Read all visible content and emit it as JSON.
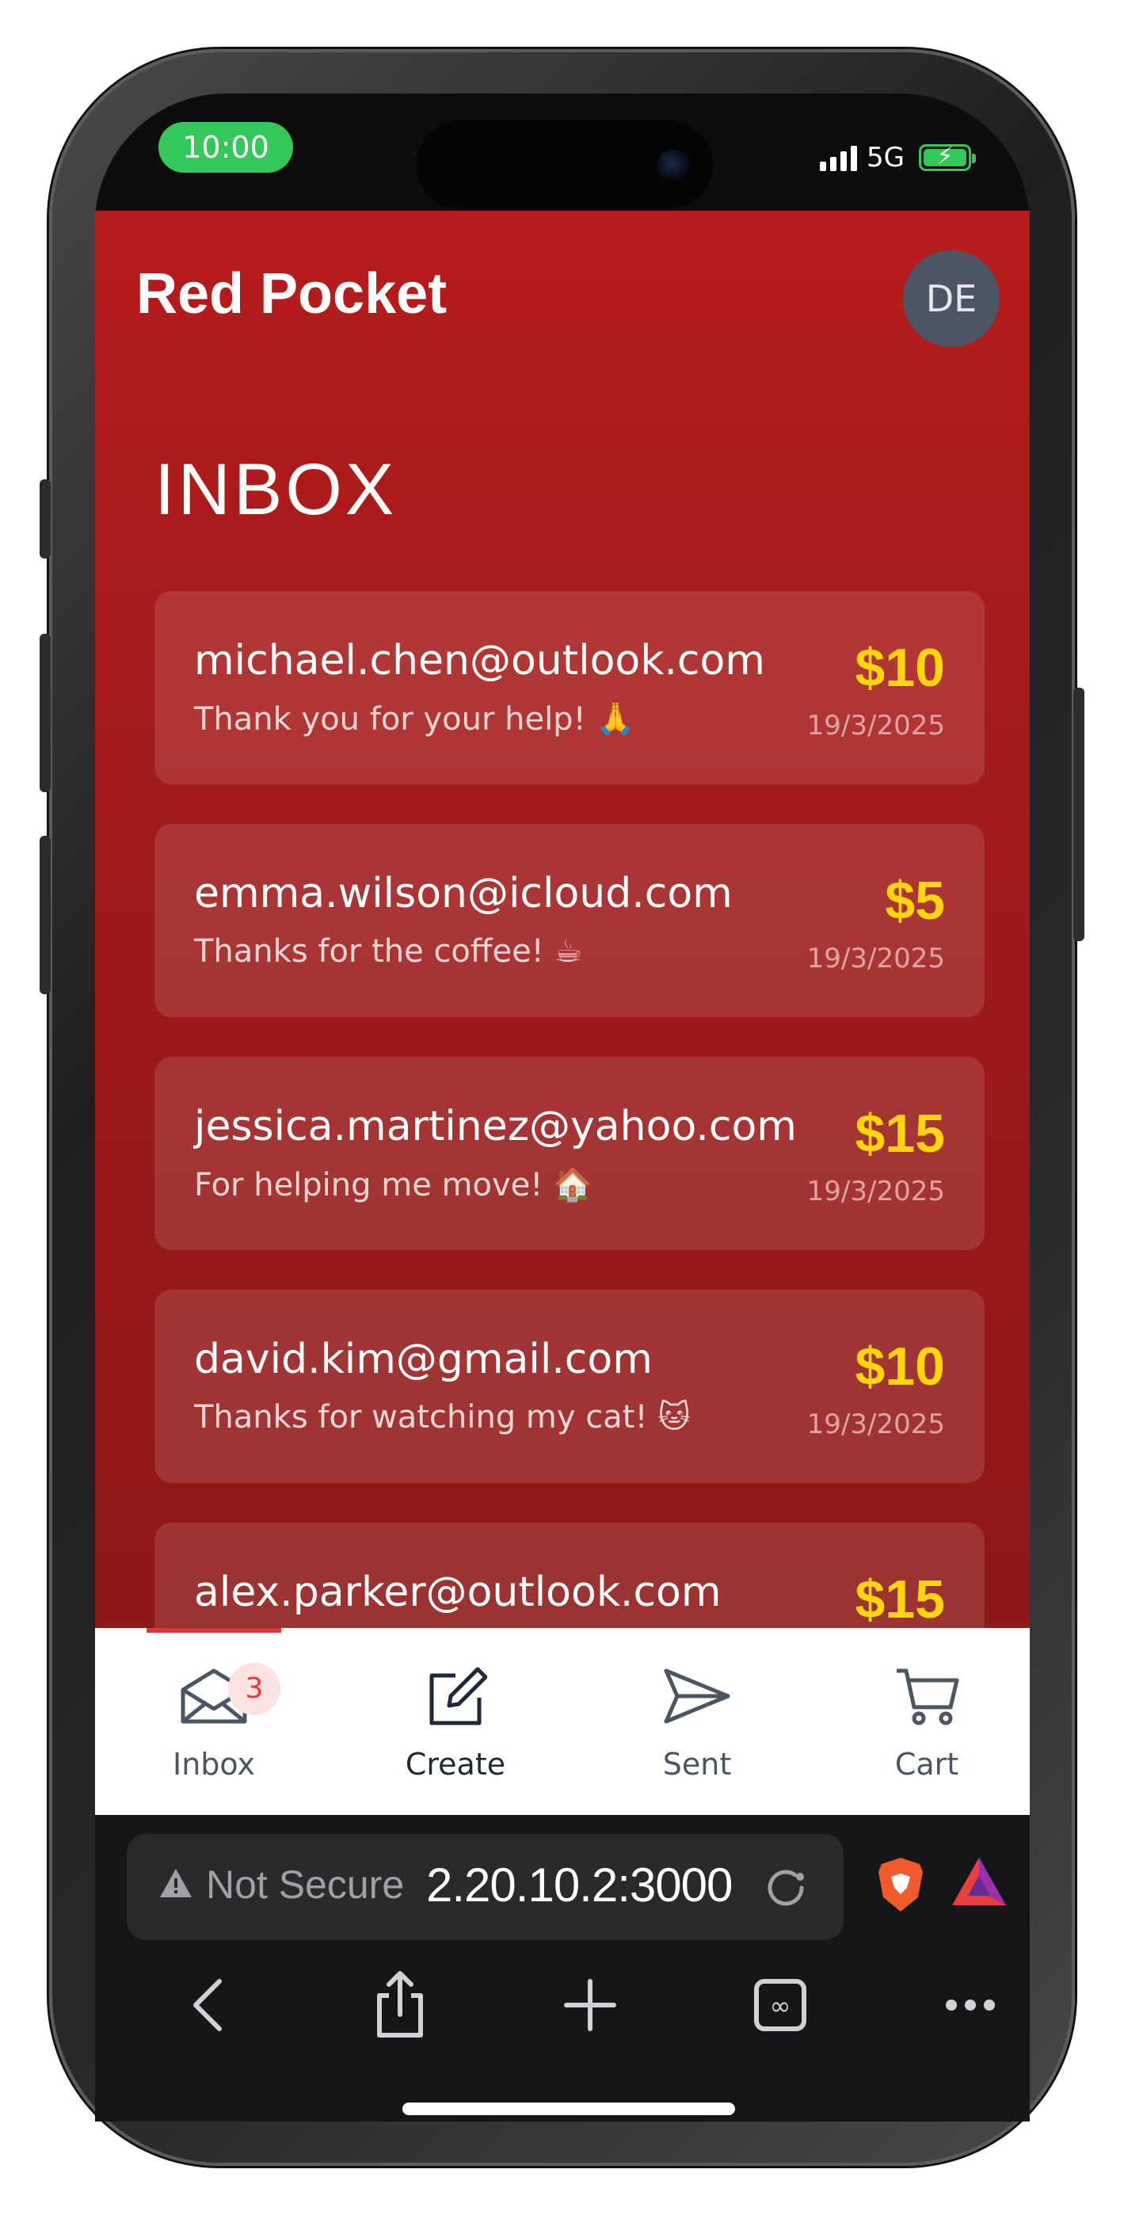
{
  "status_bar": {
    "time": "10:00",
    "network": "5G"
  },
  "header": {
    "title": "Red Pocket",
    "avatar_initials": "DE"
  },
  "inbox": {
    "heading": "INBOX",
    "messages": [
      {
        "email": "michael.chen@outlook.com",
        "note": "Thank you for your help! 🙏",
        "amount": "$10",
        "date": "19/3/2025"
      },
      {
        "email": "emma.wilson@icloud.com",
        "note": "Thanks for the coffee! ☕",
        "amount": "$5",
        "date": "19/3/2025"
      },
      {
        "email": "jessica.martinez@yahoo.com",
        "note": "For helping me move! 🏠",
        "amount": "$15",
        "date": "19/3/2025"
      },
      {
        "email": "david.kim@gmail.com",
        "note": "Thanks for watching my cat! 🐱",
        "amount": "$10",
        "date": "19/3/2025"
      },
      {
        "email": "alex.parker@outlook.com",
        "note": "",
        "amount": "$15",
        "date": ""
      }
    ]
  },
  "tabs": {
    "inbox": {
      "label": "Inbox",
      "badge": "3"
    },
    "create": {
      "label": "Create"
    },
    "sent": {
      "label": "Sent"
    },
    "cart": {
      "label": "Cart"
    }
  },
  "browser": {
    "security_label": "Not Secure",
    "url": "2.20.10.2:3000"
  },
  "colors": {
    "brand_red": "#b71c1c",
    "amount_yellow": "#ffd60a",
    "status_green": "#34c759",
    "badge_red": "#e53935"
  }
}
